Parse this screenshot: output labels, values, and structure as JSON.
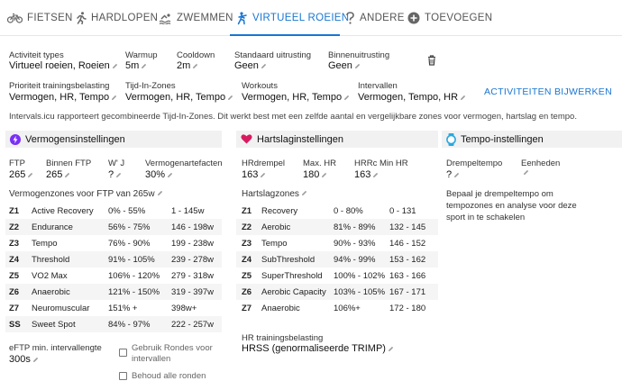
{
  "tabs": [
    {
      "label": "FIETSEN",
      "icon": "bike-icon"
    },
    {
      "label": "HARDLOPEN",
      "icon": "run-icon"
    },
    {
      "label": "ZWEMMEN",
      "icon": "swim-icon"
    },
    {
      "label": "VIRTUEEL ROEIEN",
      "icon": "row-icon",
      "active": true
    },
    {
      "label": "ANDERE",
      "icon": "question-icon"
    },
    {
      "label": "TOEVOEGEN",
      "icon": "plus-circle-icon"
    }
  ],
  "general": {
    "activity_types": {
      "label": "Activiteit types",
      "value": "Virtueel roeien, Roeien"
    },
    "warmup": {
      "label": "Warmup",
      "value": "5m"
    },
    "cooldown": {
      "label": "Cooldown",
      "value": "2m"
    },
    "default_gear": {
      "label": "Standaard uitrusting",
      "value": "Geen"
    },
    "indoor_gear": {
      "label": "Binnenuitrusting",
      "value": "Geen"
    },
    "load_priority": {
      "label": "Prioriteit trainingsbelasting",
      "value": "Vermogen, HR, Tempo"
    },
    "time_in_zones": {
      "label": "Tijd-In-Zones",
      "value": "Vermogen, HR, Tempo"
    },
    "workouts": {
      "label": "Workouts",
      "value": "Vermogen, HR, Tempo"
    },
    "intervals": {
      "label": "Intervallen",
      "value": "Vermogen, Tempo, HR"
    },
    "update_button": "ACTIVITEITEN BIJWERKEN",
    "info": "Intervals.icu rapporteert gecombineerde Tijd-In-Zones. Dit werkt best met een zelfde aantal en vergelijkbare zones voor vermogen, hartslag en tempo."
  },
  "power": {
    "title": "Vermogensinstellingen",
    "ftp": {
      "label": "FTP",
      "value": "265"
    },
    "indoor_ftp": {
      "label": "Binnen FTP",
      "value": "265"
    },
    "wprime": {
      "label": "W' J",
      "value": "?"
    },
    "power_factor": {
      "label": "Vermogenartefacten",
      "value": "30%"
    },
    "zones_title": "Vermogenzones voor FTP van 265w",
    "zones": [
      {
        "id": "Z1",
        "name": "Active Recovery",
        "pct": "0% - 55%",
        "watts": "1 - 145w"
      },
      {
        "id": "Z2",
        "name": "Endurance",
        "pct": "56% - 75%",
        "watts": "146 - 198w"
      },
      {
        "id": "Z3",
        "name": "Tempo",
        "pct": "76% - 90%",
        "watts": "199 - 238w"
      },
      {
        "id": "Z4",
        "name": "Threshold",
        "pct": "91% - 105%",
        "watts": "239 - 278w"
      },
      {
        "id": "Z5",
        "name": "VO2 Max",
        "pct": "106% - 120%",
        "watts": "279 - 318w"
      },
      {
        "id": "Z6",
        "name": "Anaerobic",
        "pct": "121% - 150%",
        "watts": "319 - 397w"
      },
      {
        "id": "Z7",
        "name": "Neuromuscular",
        "pct": "151% +",
        "watts": "398w+"
      },
      {
        "id": "SS",
        "name": "Sweet Spot",
        "pct": "84% - 97%",
        "watts": "222 - 257w"
      }
    ],
    "eftp": {
      "label": "eFTP min. intervallengte",
      "value": "300s"
    },
    "use_laps": "Gebruik Rondes voor intervallen",
    "keep_laps": "Behoud alle ronden"
  },
  "hr": {
    "title": "Hartslaginstellingen",
    "threshold": {
      "label": "HRdrempel",
      "value": "163"
    },
    "max": {
      "label": "Max. HR",
      "value": "180"
    },
    "hrrc": {
      "label": "HRRc Min HR",
      "value": "163"
    },
    "zones_title": "Hartslagzones",
    "zones": [
      {
        "id": "Z1",
        "name": "Recovery",
        "pct": "0 - 80%",
        "bpm": "0 - 131"
      },
      {
        "id": "Z2",
        "name": "Aerobic",
        "pct": "81% - 89%",
        "bpm": "132 - 145"
      },
      {
        "id": "Z3",
        "name": "Tempo",
        "pct": "90% - 93%",
        "bpm": "146 - 152"
      },
      {
        "id": "Z4",
        "name": "SubThreshold",
        "pct": "94% - 99%",
        "bpm": "153 - 162"
      },
      {
        "id": "Z5",
        "name": "SuperThreshold",
        "pct": "100% - 102%",
        "bpm": "163 - 166"
      },
      {
        "id": "Z6",
        "name": "Aerobic Capacity",
        "pct": "103% - 105%",
        "bpm": "167 - 171"
      },
      {
        "id": "Z7",
        "name": "Anaerobic",
        "pct": "106%+",
        "bpm": "172 - 180"
      }
    ],
    "load": {
      "label": "HR trainingsbelasting",
      "value": "HRSS (genormaliseerde TRIMP)"
    }
  },
  "pace": {
    "title": "Tempo-instellingen",
    "threshold": {
      "label": "Drempeltempo",
      "value": "?"
    },
    "units": {
      "label": "Eenheden",
      "value": ""
    },
    "hint": [
      "Bepaal je drempeltempo om",
      "tempozones en analyse voor deze",
      "sport in te schakelen"
    ]
  },
  "colors": {
    "accent": "#1976d2",
    "power": "#7b2ff7",
    "heart": "#d81b60",
    "pace": "#29a8e0"
  }
}
